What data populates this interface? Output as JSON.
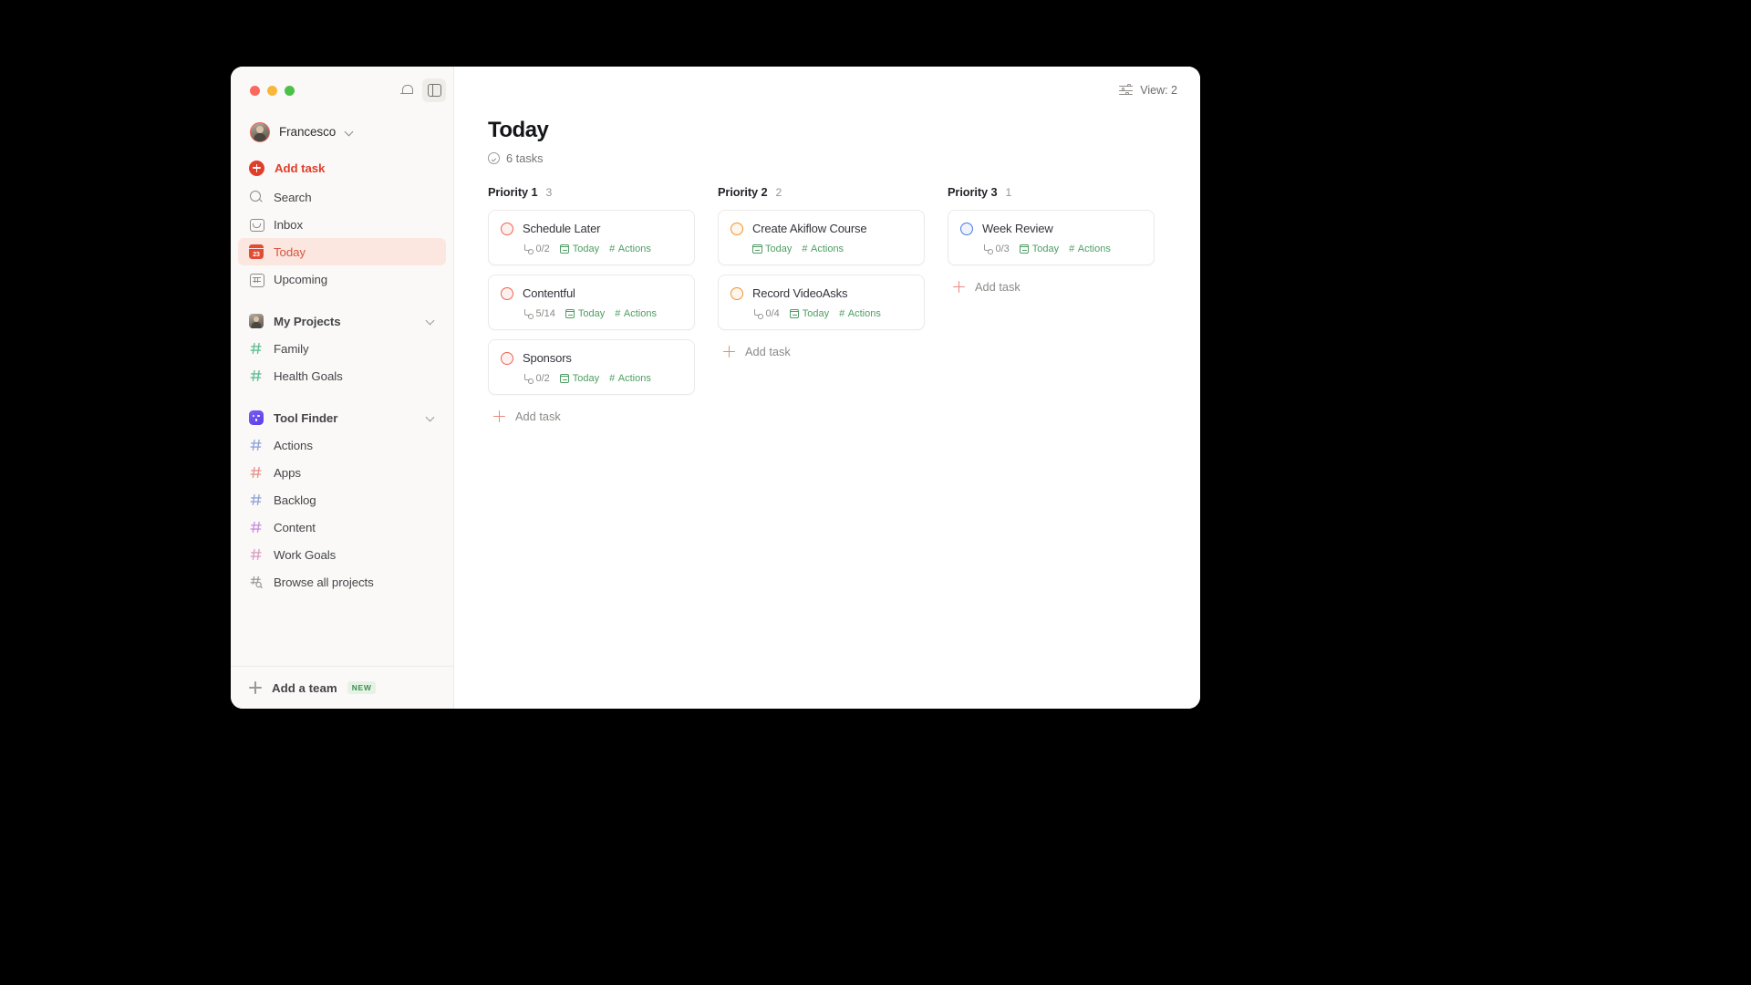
{
  "window": {
    "traffic_lights": [
      "close",
      "minimize",
      "zoom"
    ],
    "colors": {
      "close": "#F9695E",
      "minimize": "#F6B73C",
      "zoom": "#4CC14A",
      "accent_red": "#E03E2B",
      "today_bg": "#FBE7E0",
      "green": "#4E9E63"
    }
  },
  "sidebar": {
    "profile": {
      "name": "Francesco"
    },
    "nav": [
      {
        "label": "Add task",
        "icon": "plus-circle-icon"
      },
      {
        "label": "Search",
        "icon": "search-icon"
      },
      {
        "label": "Inbox",
        "icon": "inbox-icon"
      },
      {
        "label": "Today",
        "icon": "calendar-today-icon",
        "active": true,
        "day": "23"
      },
      {
        "label": "Upcoming",
        "icon": "calendar-grid-icon"
      }
    ],
    "groups": [
      {
        "label": "My Projects",
        "icon": "user-avatar-icon",
        "chevron": "chevron-down-icon",
        "projects": [
          {
            "label": "Family",
            "icon": "hash-icon",
            "color": "#5FBE93"
          },
          {
            "label": "Health Goals",
            "icon": "hash-icon",
            "color": "#5FBE93"
          }
        ]
      },
      {
        "label": "Tool Finder",
        "icon": "tool-finder-icon",
        "chevron": "chevron-down-icon",
        "projects": [
          {
            "label": "Actions",
            "icon": "hash-icon",
            "color": "#8FA4D8"
          },
          {
            "label": "Apps",
            "icon": "hash-icon",
            "color": "#E7948E"
          },
          {
            "label": "Backlog",
            "icon": "hash-icon",
            "color": "#8FA4D8"
          },
          {
            "label": "Content",
            "icon": "hash-icon",
            "color": "#C98FE0"
          },
          {
            "label": "Work Goals",
            "icon": "hash-icon",
            "color": "#D9A0C4"
          },
          {
            "label": "Browse all projects",
            "icon": "hash-search-icon",
            "color": "#9B9996"
          }
        ]
      }
    ],
    "footer": {
      "label": "Add a team",
      "badge": "NEW",
      "icon": "plus-icon"
    }
  },
  "topbar": {
    "bell": "bell-icon",
    "panel_toggle": "sidebar-panel-icon",
    "view_label": "View: 2",
    "view_icon": "sliders-icon"
  },
  "page": {
    "title": "Today",
    "task_count": "6 tasks",
    "count_icon": "check-circle-icon"
  },
  "board": {
    "add_task_label": "Add task",
    "columns": [
      {
        "title": "Priority 1",
        "count": "3",
        "status_class": "p1",
        "cards": [
          {
            "title": "Schedule Later",
            "subtasks": "0/2",
            "date": "Today",
            "project": "Actions"
          },
          {
            "title": "Contentful",
            "subtasks": "5/14",
            "date": "Today",
            "project": "Actions"
          },
          {
            "title": "Sponsors",
            "subtasks": "0/2",
            "date": "Today",
            "project": "Actions"
          }
        ]
      },
      {
        "title": "Priority 2",
        "count": "2",
        "status_class": "p2",
        "cards": [
          {
            "title": "Create Akiflow Course",
            "subtasks": "",
            "date": "Today",
            "project": "Actions"
          },
          {
            "title": "Record VideoAsks",
            "subtasks": "0/4",
            "date": "Today",
            "project": "Actions"
          }
        ]
      },
      {
        "title": "Priority 3",
        "count": "1",
        "status_class": "p3",
        "cards": [
          {
            "title": "Week Review",
            "subtasks": "0/3",
            "date": "Today",
            "project": "Actions"
          }
        ]
      }
    ]
  }
}
